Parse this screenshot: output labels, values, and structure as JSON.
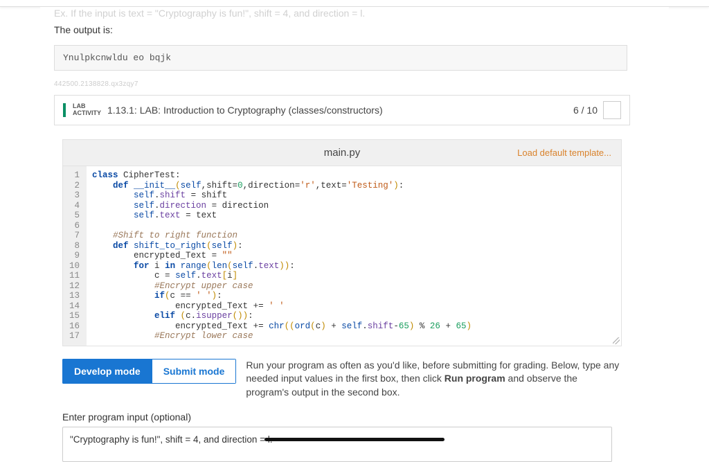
{
  "intro": {
    "line1_prefix": "Ex. If the input is text = \"Cryptography is fun!\", shift = 4, and direction = l.",
    "line2": "The output is:"
  },
  "output_sample": "Ynulpkcnwldu eo bqjk",
  "watermark": "442500.2138828.qx3zqy7",
  "lab": {
    "badge_top": "LAB",
    "badge_bottom": "ACTIVITY",
    "title": "1.13.1: LAB: Introduction to Cryptography (classes/constructors)",
    "score": "6 / 10"
  },
  "tab": {
    "filename": "main.py",
    "load_template": "Load default template..."
  },
  "code_lines": {
    "count": 17
  },
  "mode": {
    "develop": "Develop mode",
    "submit": "Submit mode"
  },
  "help": {
    "part1": "Run your program as often as you'd like, before submitting for grading. Below, type any needed input values in the first box, then click ",
    "bold": "Run program",
    "part2": " and observe the program's output in the second box."
  },
  "input": {
    "label": "Enter program input (optional)",
    "value": "\"Cryptography is fun!\", shift = 4, and direction = l."
  },
  "chart_data": {
    "type": "none",
    "note": "no chart present"
  }
}
